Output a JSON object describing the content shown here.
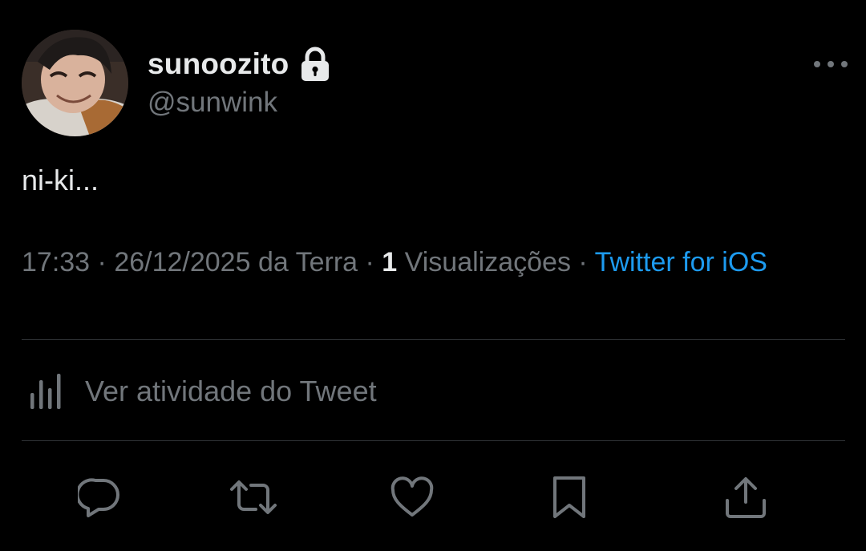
{
  "tweet": {
    "display_name": "sunoozito",
    "handle": "@sunwink",
    "text": "ni-ki...",
    "time": "17:33",
    "date": "26/12/2025 da Terra",
    "separator": "·",
    "views_count": "1",
    "views_label": "Visualizações",
    "source": "Twitter for iOS"
  },
  "icons": {
    "avatar": "profile-photo",
    "account": "lock-icon",
    "more": "more-horizontal-icon",
    "activity": "bar-chart-icon",
    "actions": [
      "reply-icon",
      "retweet-icon",
      "like-icon",
      "bookmark-icon",
      "share-icon"
    ]
  },
  "activity": {
    "label": "Ver atividade do Tweet"
  },
  "colors": {
    "background": "#000000",
    "text_primary": "#e7e9ea",
    "text_secondary": "#71767b",
    "link": "#1d9bf0",
    "divider": "#2f3336"
  }
}
